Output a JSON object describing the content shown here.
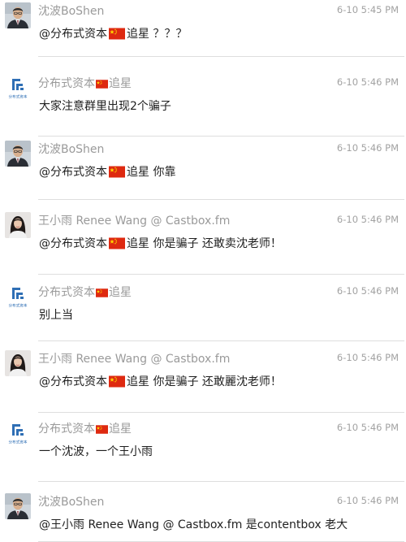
{
  "messages": [
    {
      "avatar": "man",
      "author_prefix": "沈波BoShen",
      "author_suffix": "",
      "author_flag": false,
      "time": "6-10 5:45 PM",
      "text_before": "@分布式资本",
      "text_after": "追星 ？？？",
      "text_flag": true
    },
    {
      "avatar": "logo",
      "author_prefix": "分布式资本",
      "author_suffix": "追星",
      "author_flag": true,
      "time": "6-10 5:46 PM",
      "text_before": "大家注意群里出现2个骗子",
      "text_after": "",
      "text_flag": false
    },
    {
      "avatar": "man",
      "author_prefix": "沈波BoShen",
      "author_suffix": "",
      "author_flag": false,
      "time": "6-10 5:46 PM",
      "text_before": "@分布式资本",
      "text_after": "追星 你靠",
      "text_flag": true
    },
    {
      "avatar": "woman",
      "author_prefix": "王小雨 Renee Wang @ Castbox.fm",
      "author_suffix": "",
      "author_flag": false,
      "time": "6-10 5:46 PM",
      "text_before": "@分布式资本",
      "text_after": "追星 你是骗子 还敢卖沈老师！",
      "text_flag": true
    },
    {
      "avatar": "logo",
      "author_prefix": "分布式资本",
      "author_suffix": "追星",
      "author_flag": true,
      "time": "6-10 5:46 PM",
      "text_before": "别上当",
      "text_after": "",
      "text_flag": false
    },
    {
      "avatar": "woman",
      "author_prefix": "王小雨 Renee Wang @ Castbox.fm",
      "author_suffix": "",
      "author_flag": false,
      "time": "6-10 5:46 PM",
      "text_before": "@分布式资本",
      "text_after": "追星 你是骗子 还敢麗沈老师！",
      "text_flag": true
    },
    {
      "avatar": "logo",
      "author_prefix": "分布式资本",
      "author_suffix": "追星",
      "author_flag": true,
      "time": "6-10 5:46 PM",
      "text_before": "一个沈波，一个王小雨",
      "text_after": "",
      "text_flag": false
    },
    {
      "avatar": "man",
      "author_prefix": "沈波BoShen",
      "author_suffix": "",
      "author_flag": false,
      "time": "6-10 5:46 PM",
      "text_before": "@王小雨 Renee Wang @ Castbox.fm 是contentbox 老大",
      "text_after": "",
      "text_flag": false
    }
  ],
  "logo_caption": "分布式资本",
  "colors": {
    "flag_red": "#de2910",
    "flag_star": "#ffde00",
    "logo_blue": "#2f6fb5"
  },
  "icons": {
    "man": "man-avatar-icon",
    "woman": "woman-avatar-icon",
    "logo": "fenbushi-logo-icon",
    "flag": "china-flag-icon"
  }
}
